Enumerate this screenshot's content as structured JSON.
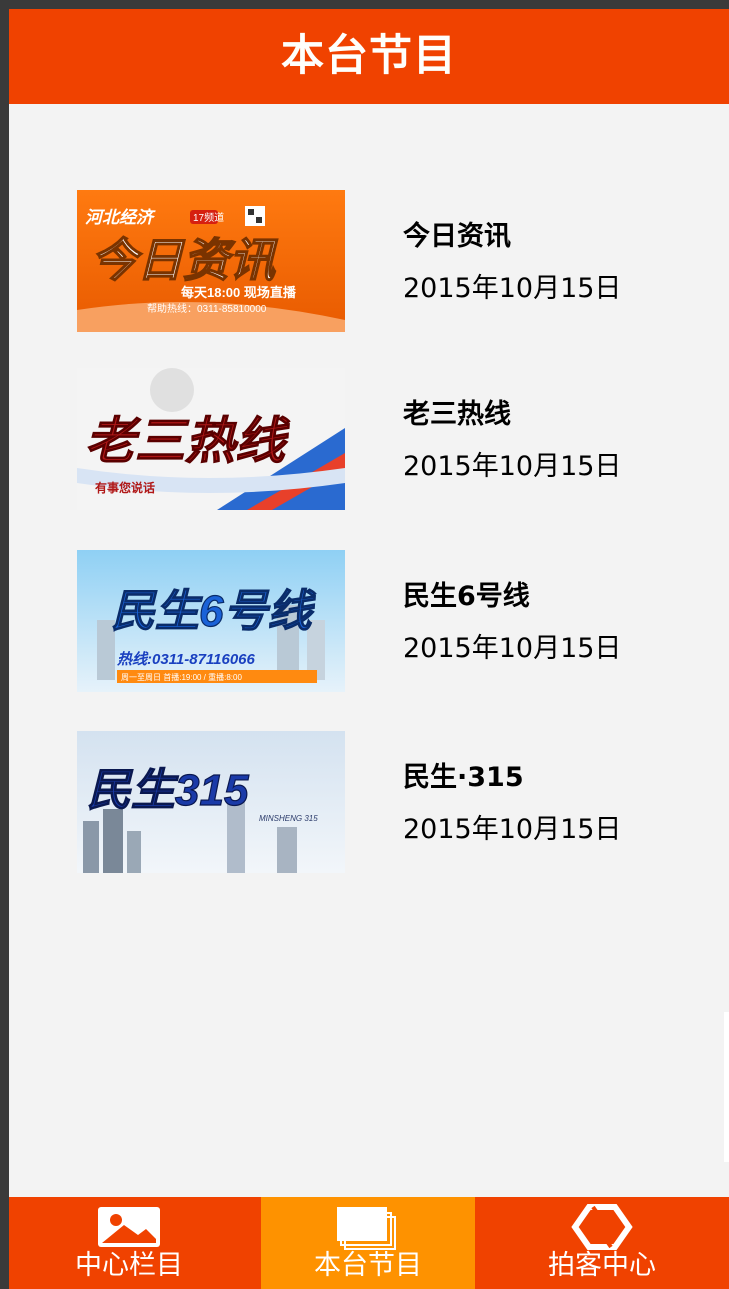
{
  "header": {
    "title": "本台节目"
  },
  "programs": [
    {
      "title": "今日资讯",
      "date": "2015年10月15日",
      "thumb": {
        "brand": "河北经济",
        "channel": "17频道",
        "name": "今日资讯",
        "schedule": "每天18:00 现场直播",
        "hotline": "帮助热线：0311-85810000"
      }
    },
    {
      "title": "老三热线",
      "date": "2015年10月15日",
      "thumb": {
        "name": "老三热线",
        "slogan": "有事您说话"
      }
    },
    {
      "title": "民生6号线",
      "date": "2015年10月15日",
      "thumb": {
        "name": "民生6号线",
        "hotline": "热线:0311-87116066",
        "schedule": "周一至周日 首播:19:00 / 重播:8:00"
      }
    },
    {
      "title": "民生·315",
      "date": "2015年10月15日",
      "thumb": {
        "name": "民生315",
        "subtitle": "MINSHENG 315"
      }
    }
  ],
  "tabs": [
    {
      "label": "中心栏目",
      "icon": "image-icon",
      "active": false
    },
    {
      "label": "本台节目",
      "icon": "stacked-pages-icon",
      "active": true
    },
    {
      "label": "拍客中心",
      "icon": "hexagon-camera-icon",
      "active": false
    }
  ],
  "colors": {
    "header": "#f04200",
    "background": "#f3f3f3",
    "tabbar": "#f04200",
    "tab_active": "#fe9200",
    "title_text": "#fefffc",
    "item_text": "#000000",
    "tab_text": "#ffffff"
  }
}
